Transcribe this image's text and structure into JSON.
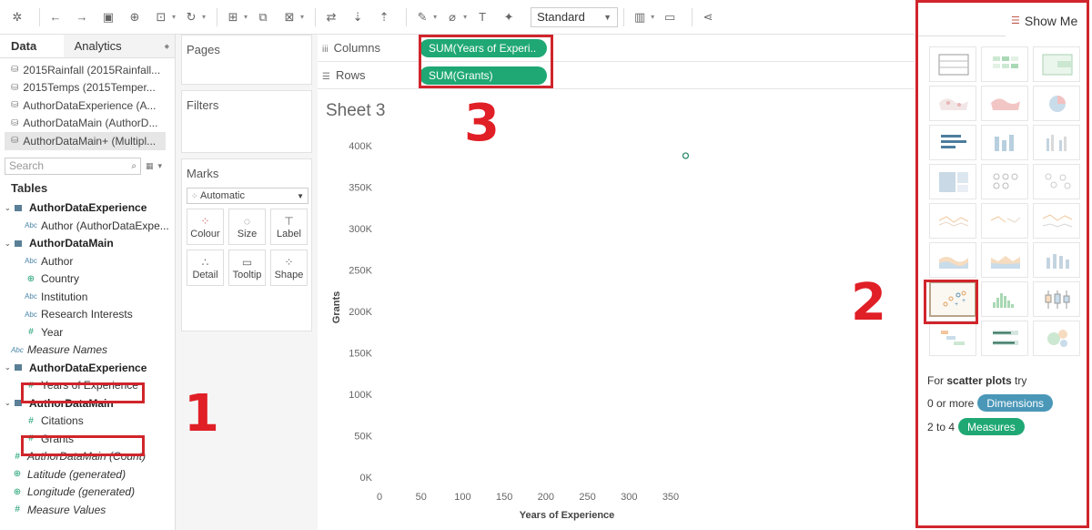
{
  "toolbar": {
    "view_mode": "Standard",
    "icons": [
      "tableau-logo-icon",
      "undo-icon",
      "redo-icon",
      "save-icon",
      "new-datasource-icon",
      "pause-updates-icon",
      "refresh-icon",
      "new-worksheet-icon",
      "duplicate-icon",
      "clear-sheet-icon",
      "swap-icon",
      "sort-asc-icon",
      "sort-desc-icon",
      "highlight-icon",
      "group-icon",
      "label-icon",
      "pin-icon",
      "chart-view-icon",
      "presentation-icon",
      "share-icon"
    ]
  },
  "data_pane": {
    "tab_data": "Data",
    "tab_analytics": "Analytics",
    "datasources": [
      "2015Rainfall (2015Rainfall...",
      "2015Temps (2015Temper...",
      "AuthorDataExperience (A...",
      "AuthorDataMain (AuthorD...",
      "AuthorDataMain+ (Multipl..."
    ],
    "search_placeholder": "Search",
    "tables_heading": "Tables",
    "fields": [
      {
        "kind": "table",
        "label": "AuthorDataExperience"
      },
      {
        "kind": "abc",
        "label": "Author (AuthorDataExpe..."
      },
      {
        "kind": "table",
        "label": "AuthorDataMain"
      },
      {
        "kind": "abc",
        "label": "Author"
      },
      {
        "kind": "geo",
        "label": "Country"
      },
      {
        "kind": "abc",
        "label": "Institution"
      },
      {
        "kind": "abc",
        "label": "Research Interests"
      },
      {
        "kind": "num",
        "label": "Year"
      },
      {
        "kind": "abc0",
        "label": "Measure Names"
      },
      {
        "kind": "table",
        "label": "AuthorDataExperience"
      },
      {
        "kind": "num",
        "label": "Years of Experience"
      },
      {
        "kind": "table",
        "label": "AuthorDataMain"
      },
      {
        "kind": "num",
        "label": "Citations"
      },
      {
        "kind": "num",
        "label": "Grants"
      },
      {
        "kind": "num0",
        "label": "AuthorDataMain (Count)"
      },
      {
        "kind": "geo0",
        "label": "Latitude (generated)"
      },
      {
        "kind": "geo0",
        "label": "Longitude (generated)"
      },
      {
        "kind": "num0",
        "label": "Measure Values"
      }
    ]
  },
  "cards": {
    "pages": "Pages",
    "filters": "Filters",
    "marks": "Marks",
    "mark_type": "Automatic",
    "mark_buttons": [
      "Colour",
      "Size",
      "Label",
      "Detail",
      "Tooltip",
      "Shape"
    ]
  },
  "shelves": {
    "columns_label": "Columns",
    "rows_label": "Rows",
    "columns_pill": "SUM(Years of Experi..",
    "rows_pill": "SUM(Grants)"
  },
  "sheet": {
    "title": "Sheet 3"
  },
  "chart_data": {
    "type": "scatter",
    "title": "",
    "xlabel": "Years of Experience",
    "ylabel": "Grants",
    "x_ticks": [
      "0",
      "50",
      "100",
      "150",
      "200",
      "250",
      "300",
      "350"
    ],
    "y_ticks": [
      "0K",
      "50K",
      "100K",
      "150K",
      "200K",
      "250K",
      "300K",
      "350K",
      "400K"
    ],
    "xlim": [
      0,
      385
    ],
    "ylim": [
      0,
      410000
    ],
    "points": [
      {
        "x": 368,
        "y": 388000
      }
    ],
    "grid": false,
    "color": "#2e8b6e"
  },
  "show_me": {
    "title": "Show Me",
    "hint_prefix": "For",
    "hint_bold": "scatter plots",
    "hint_suffix": "try",
    "dims_prefix": "0 or more",
    "dims_label": "Dimensions",
    "meas_prefix": "2 to 4",
    "meas_label": "Measures",
    "dims_color": "#4a97b8",
    "meas_color": "#1fa874"
  },
  "annotations": {
    "step1": "1",
    "step2": "2",
    "step3": "3",
    "color": "#e01f26"
  }
}
